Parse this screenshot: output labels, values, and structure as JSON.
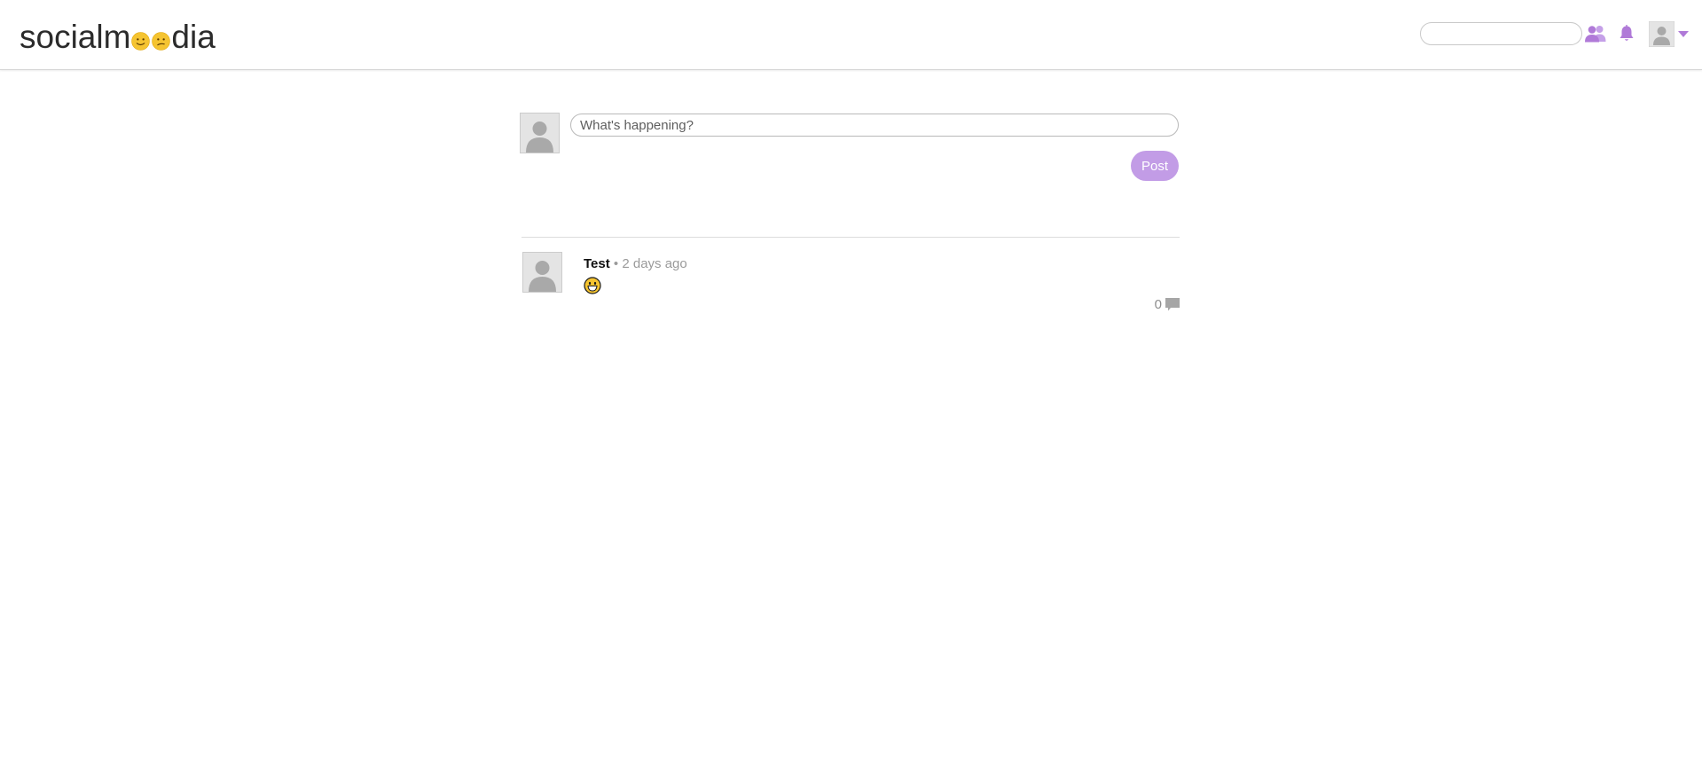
{
  "header": {
    "logo": {
      "text_before": "socialm",
      "emoji_1": "slightly-smiling-face",
      "emoji_2": "confused-face",
      "text_after": "dia"
    },
    "search": {
      "value": "",
      "placeholder": ""
    },
    "icons": [
      "friends-icon",
      "bell-icon",
      "avatar",
      "chevron-down-icon"
    ]
  },
  "composer": {
    "placeholder": "What's happening?",
    "value": "",
    "post_label": "Post"
  },
  "posts": [
    {
      "author": "Test",
      "separator": "•",
      "time": "2 days ago",
      "content_emoji": "grinning-face",
      "comment_count": "0"
    }
  ],
  "colors": {
    "accent": "#c29ce6",
    "icon_accent": "#b07ad8",
    "text_dark": "#2b2b2b",
    "text_muted": "#9a9a9a",
    "divider": "#dcdcdc"
  }
}
